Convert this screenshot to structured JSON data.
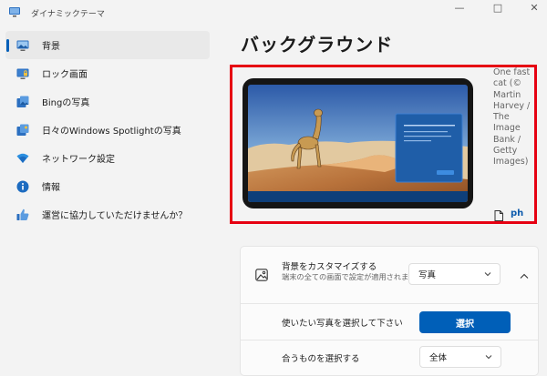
{
  "app": {
    "title": "ダイナミックテーマ"
  },
  "window_controls": {
    "minimize": "—",
    "maximize": "□",
    "close": "✕"
  },
  "sidebar": {
    "items": [
      {
        "label": "背景",
        "icon": "monitor-icon",
        "active": true
      },
      {
        "label": "ロック画面",
        "icon": "lock-screen-icon",
        "active": false
      },
      {
        "label": "Bingの写真",
        "icon": "photos-icon",
        "active": false
      },
      {
        "label": "日々のWindows Spotlightの写真",
        "icon": "spotlight-icon",
        "active": false
      },
      {
        "label": "ネットワーク設定",
        "icon": "wifi-icon",
        "active": false
      },
      {
        "label": "情報",
        "icon": "info-icon",
        "active": false
      },
      {
        "label": "運営に協力していただけませんか？",
        "icon": "thumbs-up-icon",
        "active": false
      }
    ]
  },
  "main": {
    "title": "バックグラウンド",
    "preview": {
      "credit_text": "One fast cat (© Martin Harvey / The Image Bank / Getty Images)",
      "credit_link": "ph"
    },
    "settings": {
      "customize": {
        "title": "背景をカスタマイズする",
        "description": "端末の全ての画面で設定が適用されます",
        "value": "写真"
      },
      "choose_photo": {
        "label": "使いたい写真を選択して下さい",
        "button": "選択"
      },
      "fit": {
        "label": "合うものを選択する",
        "value": "全体"
      }
    }
  },
  "colors": {
    "accent": "#005fb8",
    "highlight_border": "#e60012",
    "window_bg": "#f3f3f3",
    "card_bg": "#fbfbfb"
  }
}
